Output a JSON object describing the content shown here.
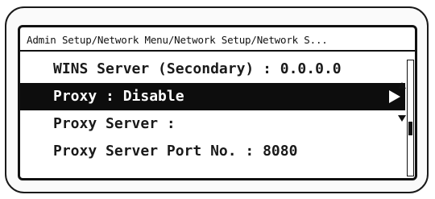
{
  "breadcrumb": "Admin Setup/Network Menu/Network Setup/Network S...",
  "menu": {
    "items": [
      {
        "label": "WINS Server (Secondary) : 0.0.0.0"
      },
      {
        "label": "Proxy : Disable"
      },
      {
        "label": "Proxy Server :"
      },
      {
        "label": "Proxy Server Port No. : 8080"
      }
    ],
    "selected_index": 1
  },
  "scrollbar": {
    "position_fraction": 0.6
  },
  "icons": {
    "select_arrow": "right-triangle-icon",
    "scroll_up": "triangle-up-icon",
    "scroll_down": "triangle-down-icon"
  }
}
